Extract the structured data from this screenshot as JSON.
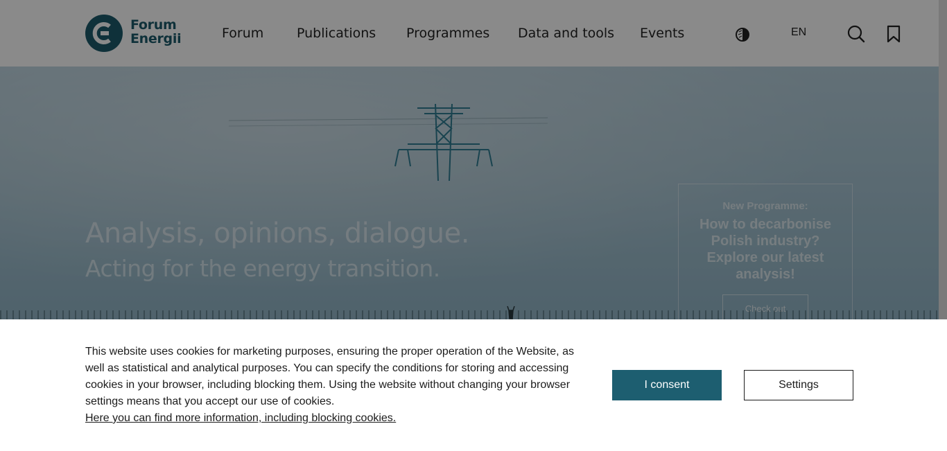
{
  "header": {
    "logo_line1": "Forum",
    "logo_line2": "Energii",
    "nav": [
      {
        "label": "Forum"
      },
      {
        "label": "Publications"
      },
      {
        "label": "Programmes"
      },
      {
        "label": "Data and tools"
      },
      {
        "label": "Events"
      }
    ],
    "language": "EN",
    "icons": [
      "contrast-icon",
      "search-icon",
      "bookmark-icon"
    ]
  },
  "hero": {
    "title": "Analysis, opinions, dialogue.",
    "subtitle": "Acting for the energy transition.",
    "promo_label": "New Programme:",
    "promo_text": "How to decarbonise Polish industry? Explore our latest analysis!",
    "promo_button": "Check out"
  },
  "cookie": {
    "text": "This website uses cookies for marketing purposes, ensuring the proper operation of the Website, as well as statistical and analytical purposes. You can specify the conditions for storing and accessing cookies in your browser, including blocking them. Using the website without changing your browser settings means that you accept our use of cookies.",
    "link": "Here you can find more information, including blocking cookies.",
    "consent_button": "I consent",
    "settings_button": "Settings"
  },
  "colors": {
    "brand": "#1d5e70",
    "logo_text": "#1d5c6c",
    "logo_accent": "#c0392b"
  }
}
